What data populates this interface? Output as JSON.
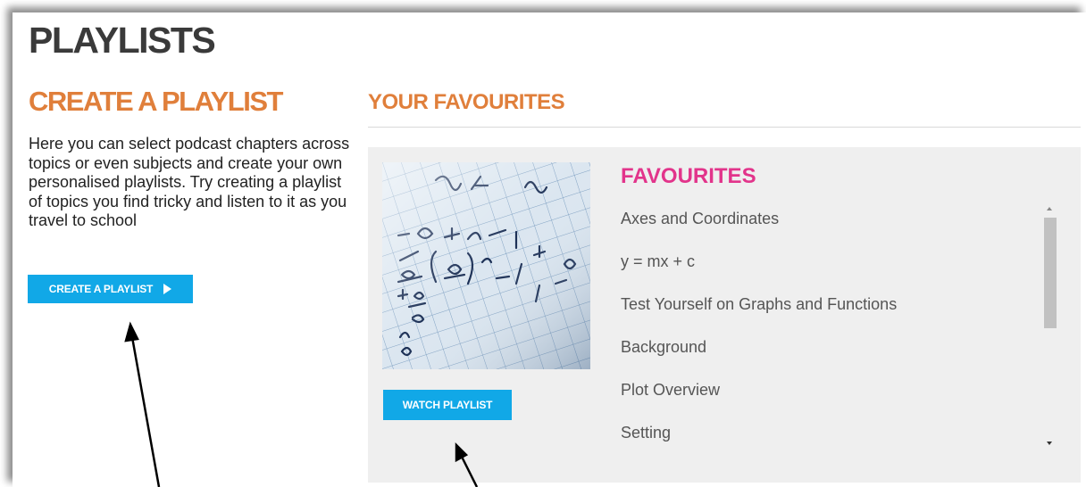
{
  "page": {
    "title": "PLAYLISTS"
  },
  "create": {
    "heading": "CREATE A PLAYLIST",
    "description": "Here you can select podcast chapters across topics or even subjects and create your own personalised playlists. Try creating a playlist of topics you find tricky and listen to it as you travel to school",
    "button_label": "CREATE A PLAYLIST"
  },
  "favourites": {
    "section_heading": "YOUR FAVOURITES",
    "list_title": "FAVOURITES",
    "watch_button_label": "WATCH PLAYLIST",
    "items": [
      {
        "label": "Axes and Coordinates"
      },
      {
        "label": "y = mx + c"
      },
      {
        "label": "Test Yourself on Graphs and Functions"
      },
      {
        "label": "Background"
      },
      {
        "label": "Plot Overview"
      },
      {
        "label": "Setting"
      }
    ]
  },
  "colors": {
    "title_gray": "#3a3a3a",
    "orange_heading": "#e07f3b",
    "pink_heading": "#e2348b",
    "button_blue": "#11a8e7",
    "panel_bg": "#efefef"
  },
  "icons": {
    "play_triangle": "play-icon",
    "scroll_up": "chevron-up-icon",
    "scroll_down": "chevron-down-icon"
  }
}
